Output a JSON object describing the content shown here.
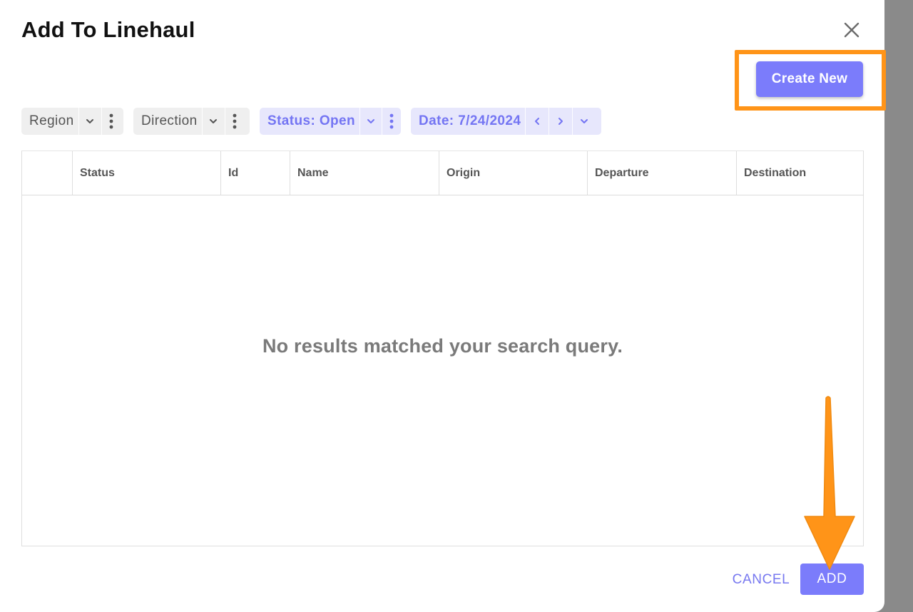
{
  "dialog": {
    "title": "Add To Linehaul",
    "close_icon": "close-icon"
  },
  "toolbar": {
    "create_new_label": "Create New"
  },
  "filters": {
    "region_label": "Region",
    "direction_label": "Direction",
    "status_label": "Status: Open",
    "date_label": "Date: 7/24/2024"
  },
  "table": {
    "columns": [
      "",
      "Status",
      "Id",
      "Name",
      "Origin",
      "Departure",
      "Destination"
    ],
    "empty_message": "No results matched your search query."
  },
  "footer": {
    "cancel_label": "CANCEL",
    "add_label": "ADD"
  },
  "colors": {
    "accent": "#7b7cfb",
    "highlight": "#ff9418",
    "chip_grey": "#efefef",
    "chip_blue": "#e7e7fc"
  }
}
